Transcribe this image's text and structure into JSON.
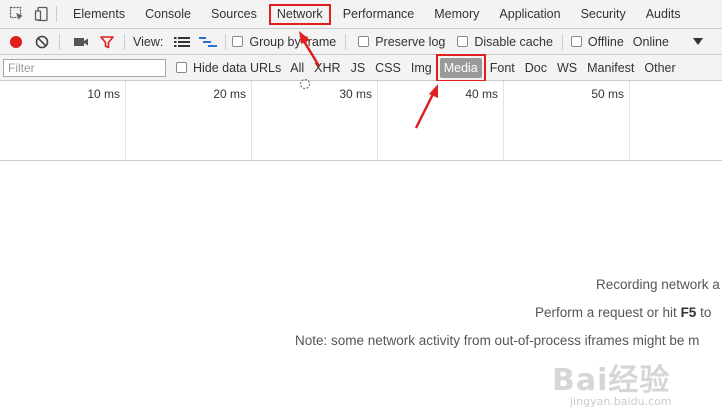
{
  "tabs": {
    "items": [
      "Elements",
      "Console",
      "Sources",
      "Network",
      "Performance",
      "Memory",
      "Application",
      "Security",
      "Audits"
    ],
    "active": "Network"
  },
  "toolbar": {
    "view_label": "View:",
    "group_by_frame": "Group by frame",
    "preserve_log": "Preserve log",
    "disable_cache": "Disable cache",
    "offline": "Offline",
    "throttle_value": "Online",
    "record_color": "#e01e1e",
    "filter_icon_color": "#e01e1e"
  },
  "filterbar": {
    "placeholder": "Filter",
    "hide_data_urls": "Hide data URLs",
    "types": [
      "All",
      "XHR",
      "JS",
      "CSS",
      "Img",
      "Media",
      "Font",
      "Doc",
      "WS",
      "Manifest",
      "Other"
    ],
    "selected": "Media"
  },
  "timeline": {
    "ticks": [
      "10 ms",
      "20 ms",
      "30 ms",
      "40 ms",
      "50 ms"
    ]
  },
  "empty_state": {
    "line1": "Recording network a",
    "line2_prefix": "Perform a request or hit ",
    "line2_key": "F5",
    "line2_suffix": " to",
    "line3": "Note: some network activity from out-of-process iframes might be m"
  },
  "watermark": {
    "logo": "Bai经验",
    "sub": "jingyan.baidu.com"
  }
}
